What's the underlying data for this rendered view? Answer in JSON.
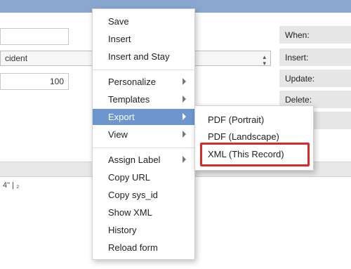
{
  "form": {
    "fields": [
      {
        "value": ""
      },
      {
        "value": "cident"
      },
      {
        "value": "100"
      }
    ],
    "right_labels": [
      "When:",
      "Insert:",
      "Update:",
      "Delete:",
      "...:"
    ],
    "stub_text": "4\" | ₂"
  },
  "context_menu": {
    "items": [
      {
        "label": "Save",
        "has_submenu": false
      },
      {
        "label": "Insert",
        "has_submenu": false
      },
      {
        "label": "Insert and Stay",
        "has_submenu": false
      },
      {
        "label": "Personalize",
        "has_submenu": true
      },
      {
        "label": "Templates",
        "has_submenu": true
      },
      {
        "label": "Export",
        "has_submenu": true,
        "active": true
      },
      {
        "label": "View",
        "has_submenu": true
      },
      {
        "label": "Assign Label",
        "has_submenu": true
      },
      {
        "label": "Copy URL",
        "has_submenu": false
      },
      {
        "label": "Copy sys_id",
        "has_submenu": false
      },
      {
        "label": "Show XML",
        "has_submenu": false
      },
      {
        "label": "History",
        "has_submenu": false
      },
      {
        "label": "Reload form",
        "has_submenu": false
      }
    ]
  },
  "export_submenu": {
    "items": [
      {
        "label": "PDF (Portrait)"
      },
      {
        "label": "PDF (Landscape)"
      },
      {
        "label": "XML (This Record)",
        "highlighted": true
      }
    ]
  },
  "colors": {
    "header": "#8aa7cf",
    "active_item": "#6d96cf",
    "highlight_border": "#d52b2b"
  }
}
